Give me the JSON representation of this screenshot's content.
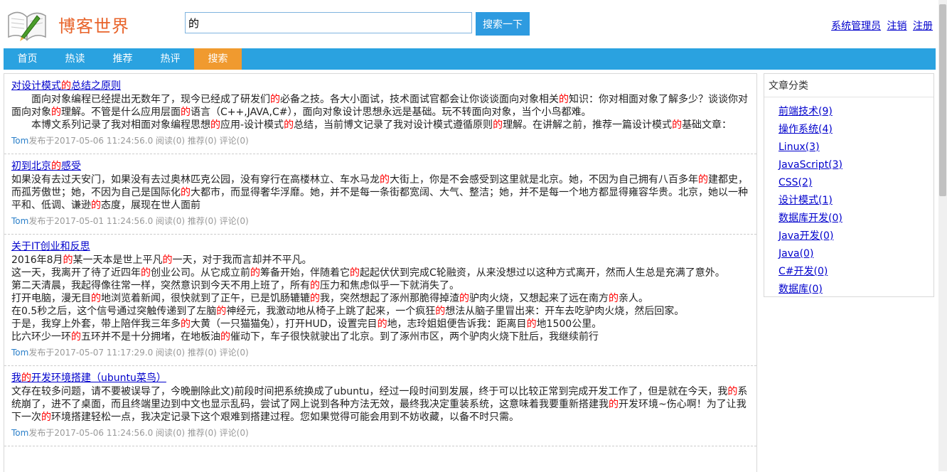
{
  "header": {
    "site_title": "博客世界",
    "search_value": "的",
    "search_button": "搜索一下",
    "user_links": [
      "系统管理员",
      "注销",
      "注册"
    ]
  },
  "nav": [
    "首页",
    "热读",
    "推荐",
    "热评",
    "搜索"
  ],
  "nav_active": "搜索",
  "sidebar": {
    "title": "文章分类",
    "categories": [
      "前端技术(9)",
      "操作系统(4)",
      "Linux(3)",
      "JavaScript(3)",
      "CSS(2)",
      "设计模式(1)",
      "数据库开发(0)",
      "Java开发(0)",
      "Java(0)",
      "C#开发(0)",
      "数据库(0)"
    ]
  },
  "articles": [
    {
      "title": "对设计模式的总结之原则",
      "paragraphs": [
        "面向对象编程已经提出无数年了，现今已经成了研发们的必备之技。各大小面试，技术面试官都会让你谈谈面向对象相关的知识：你对相面对象了解多少？谈谈你对面向对象的理解。不管是什么应用层面的语言（C++,JAVA,C#），面向对象设计思想永远是基础。玩不转面向对象，当个小鸟都难。",
        "本博文系列记录了我对相面对象编程思想的应用-设计模式的总结，当前博文记录了我对设计模式遵循原则的理解。在讲解之前，推荐一篇设计模式的基础文章："
      ],
      "indent": true,
      "author": "Tom",
      "meta": "发布于2017-05-06 11:24:56.0 阅读(0) 推荐(0) 评论(0)"
    },
    {
      "title": "初到北京的感受",
      "paragraphs": [
        "如果没有去过天安门，如果没有去过奥林匹克公园，没有穿行在高楼林立、车水马龙的大街上，你是不会感受到这里就是北京。她，不因为自己拥有八百多年的建都史，而孤芳傲世；她，不因为自己是国际化的大都市，而显得奢华浮靡。她，并不是每一条街都宽阔、大气、整洁；她，并不是每一个地方都显得雍容华贵。北京，她以一种平和、低调、谦逊的态度，展现在世人面前"
      ],
      "indent": false,
      "author": "Tom",
      "meta": "发布于2017-05-01 11:24:56.0 阅读(0) 推荐(0) 评论(0)"
    },
    {
      "title": "关于IT创业和反思",
      "paragraphs": [
        "2016年8月的某一天本是世上平凡的一天，对于我而言却并不平凡。",
        "这一天，我离开了待了近四年的创业公司。从它成立前的筹备开始，伴随着它的起起伏伏到完成C轮融资，从来没想过以这种方式离开，然而人生总是充满了意外。",
        "第二天清晨，我起得像往常一样，突然意识到今天不用上班了，所有的压力和焦虑似乎一下就消失了。",
        "打开电脑，漫无目的地浏览着新闻，很快就到了正午，已是饥肠辘辘的我，突然想起了涿州那脆得掉渣的驴肉火烧，又想起来了远在南方的亲人。",
        "在0.5秒之后，这个信号通过突触传递到了左脑的神经元，我激动地从椅子上跳了起来，一个疯狂的想法从脑子里冒出来：开车去吃驴肉火烧，然后回家。",
        "于是，我穿上外套，带上陪伴我三年多的大黄（一只猫猫兔），打开HUD，设置完目的地，志玲姐姐便告诉我：距离目的地1500公里。",
        "比六环少一环的五环并不是十分拥堵，在地板油的催动下，车子很快就驶出了北京。到了涿州市区，两个驴肉火烧下肚后，我继续前行"
      ],
      "indent": false,
      "author": "Tom",
      "meta": "发布于2017-05-07 11:17:29.0 阅读(0) 推荐(0) 评论(0)"
    },
    {
      "title": "我的开发环境搭建（ubuntu菜鸟）",
      "paragraphs": [
        "文存在较多问题，请不要被误导了，今晚删除此文)前段时间把系统换成了ubuntu，经过一段时间到发展，终于可以比较正常到完成开发工作了，但是就在今天，我的系统崩了，进不了桌面，而且终端里边到中文也显示乱码，尝试了网上说到各种方法无效，最终我决定重装系统，这意味着我要重新搭建我的开发环境~伤心啊！为了让我下一次的环境搭建轻松一点，我决定记录下这个艰难到搭建过程。您如果觉得可能会用到不妨收藏，以备不时只需。"
      ],
      "indent": false,
      "author": "Tom",
      "meta": "发布于2017-05-06 11:24:56.0 阅读(0) 推荐(0) 评论(0)"
    }
  ]
}
